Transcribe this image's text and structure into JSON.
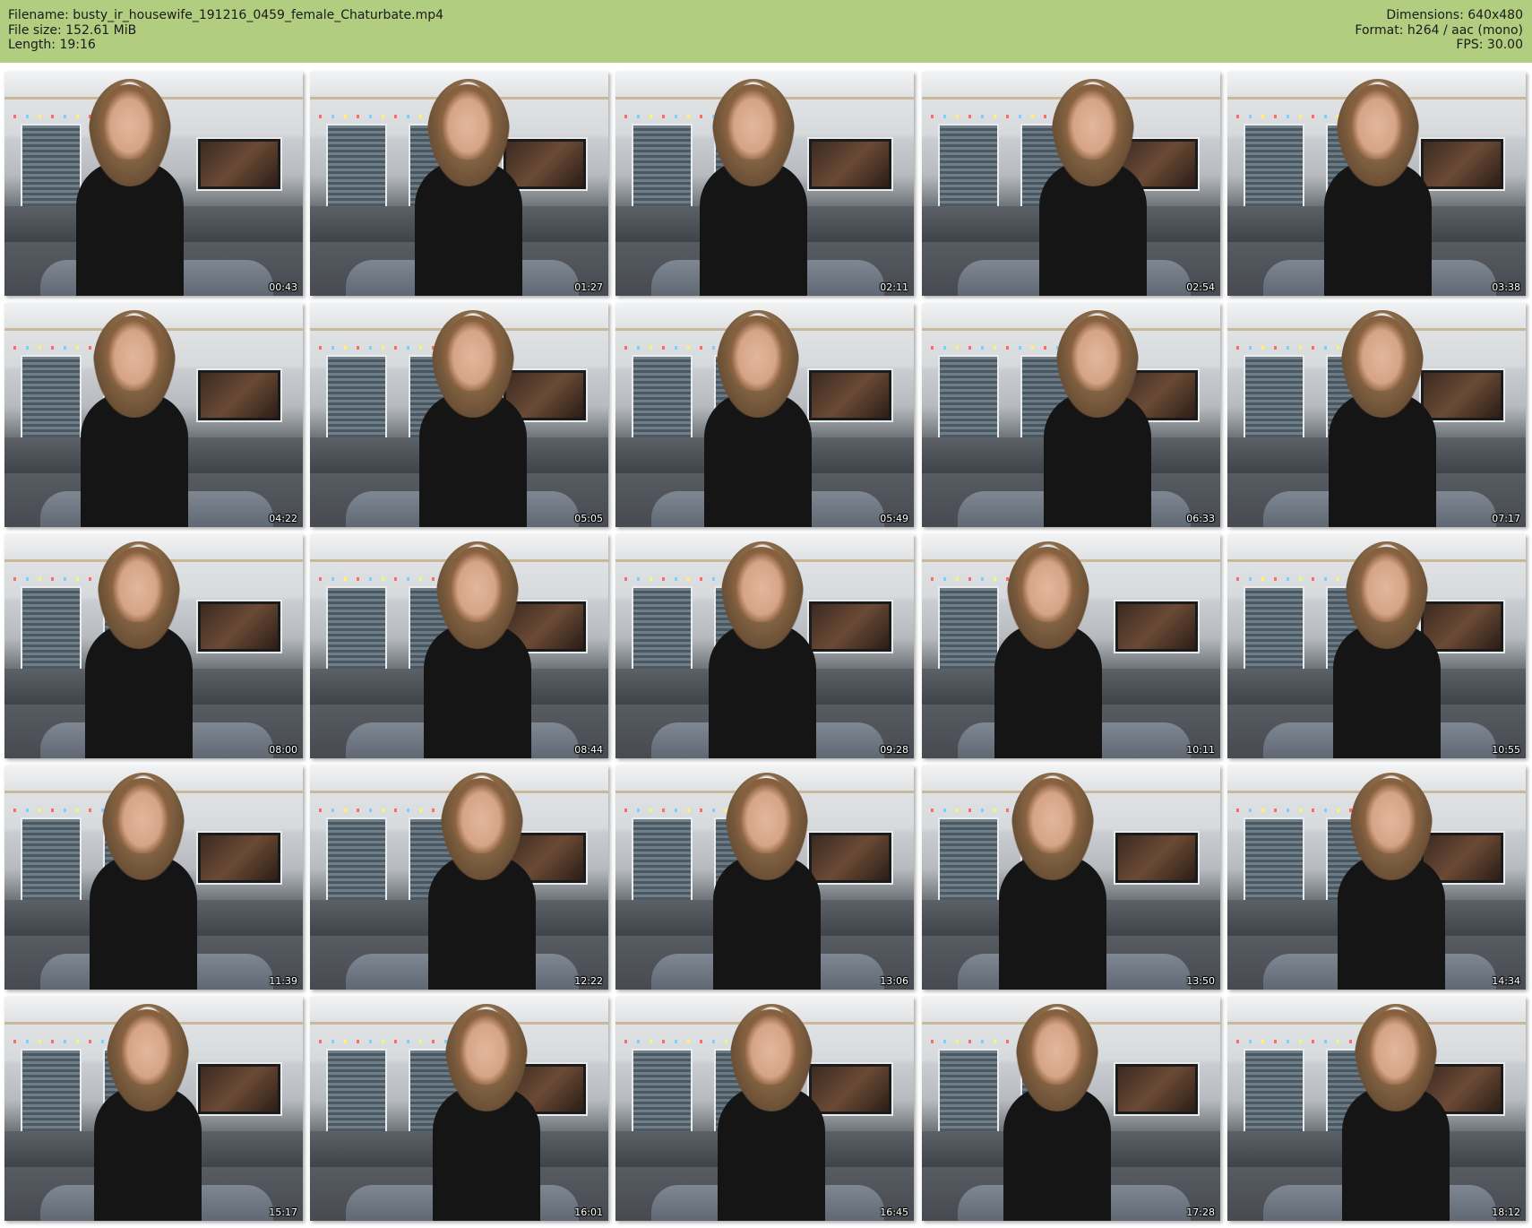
{
  "header": {
    "filename": "Filename: busty_ir_housewife_191216_0459_female_Chaturbate.mp4",
    "filesize": "File size: 152.61 MiB",
    "length": "Length: 19:16",
    "dimensions": "Dimensions: 640x480",
    "format": "Format: h264 / aac (mono)",
    "fps": "FPS: 30.00",
    "background_color": "#b1ce80"
  },
  "thumbnails": [
    {
      "timestamp": "00:43"
    },
    {
      "timestamp": "01:27"
    },
    {
      "timestamp": "02:11"
    },
    {
      "timestamp": "02:54"
    },
    {
      "timestamp": "03:38"
    },
    {
      "timestamp": "04:22"
    },
    {
      "timestamp": "05:05"
    },
    {
      "timestamp": "05:49"
    },
    {
      "timestamp": "06:33"
    },
    {
      "timestamp": "07:17"
    },
    {
      "timestamp": "08:00"
    },
    {
      "timestamp": "08:44"
    },
    {
      "timestamp": "09:28"
    },
    {
      "timestamp": "10:11"
    },
    {
      "timestamp": "10:55"
    },
    {
      "timestamp": "11:39"
    },
    {
      "timestamp": "12:22"
    },
    {
      "timestamp": "13:06"
    },
    {
      "timestamp": "13:50"
    },
    {
      "timestamp": "14:34"
    },
    {
      "timestamp": "15:17"
    },
    {
      "timestamp": "16:01"
    },
    {
      "timestamp": "16:45"
    },
    {
      "timestamp": "17:28"
    },
    {
      "timestamp": "18:12"
    }
  ]
}
